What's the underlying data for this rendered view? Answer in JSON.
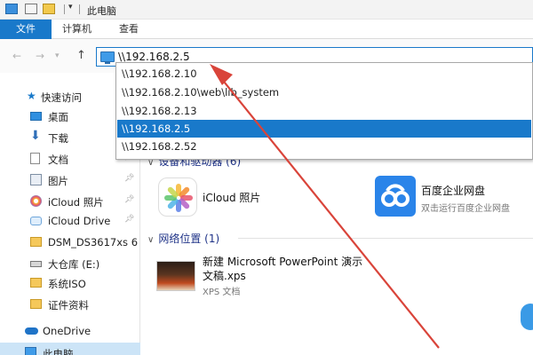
{
  "window": {
    "title": "此电脑"
  },
  "ribbon": {
    "tabs": [
      "文件",
      "计算机",
      "查看"
    ]
  },
  "address_bar": {
    "value": "\\\\192.168.2.5"
  },
  "autocomplete": {
    "items": [
      "\\\\192.168.2.10",
      "\\\\192.168.2.10\\web\\lib_system",
      "\\\\192.168.2.13",
      "\\\\192.168.2.5",
      "\\\\192.168.2.52"
    ],
    "selected_index": 3
  },
  "sidebar": {
    "items": [
      {
        "label": "快速访问",
        "icon": "star-icon",
        "pinned": false
      },
      {
        "label": "桌面",
        "icon": "desktop-icon",
        "pinned": true
      },
      {
        "label": "下载",
        "icon": "download-icon",
        "pinned": true
      },
      {
        "label": "文档",
        "icon": "document-icon",
        "pinned": true
      },
      {
        "label": "图片",
        "icon": "pictures-icon",
        "pinned": true
      },
      {
        "label": "iCloud 照片",
        "icon": "icloud-photos-icon",
        "pinned": true
      },
      {
        "label": "iCloud Drive",
        "icon": "icloud-drive-icon",
        "pinned": true
      },
      {
        "label": "DSM_DS3617xs 6.",
        "icon": "folder-icon",
        "pinned": false
      },
      {
        "label": "大仓库 (E:)",
        "icon": "drive-icon",
        "pinned": false
      },
      {
        "label": "系统ISO",
        "icon": "folder-icon",
        "pinned": false
      },
      {
        "label": "证件资料",
        "icon": "folder-icon",
        "pinned": false
      },
      {
        "label": "OneDrive",
        "icon": "onedrive-icon",
        "pinned": false
      },
      {
        "label": "此电脑",
        "icon": "this-pc-icon",
        "pinned": false
      }
    ]
  },
  "main": {
    "devices_header": "设备和驱动器 (6)",
    "network_header": "网络位置 (1)",
    "icloud_label": "iCloud 照片",
    "baidu_title": "百度企业网盘",
    "baidu_subtitle": "双击运行百度企业网盘",
    "ppt_title_line1": "新建 Microsoft PowerPoint 演示",
    "ppt_title_line2": "文稿.xps",
    "ppt_subtitle": "XPS 文档"
  },
  "colors": {
    "accent": "#1979ca",
    "selection": "#cce4f7",
    "annotation_arrow": "#d9443a"
  }
}
